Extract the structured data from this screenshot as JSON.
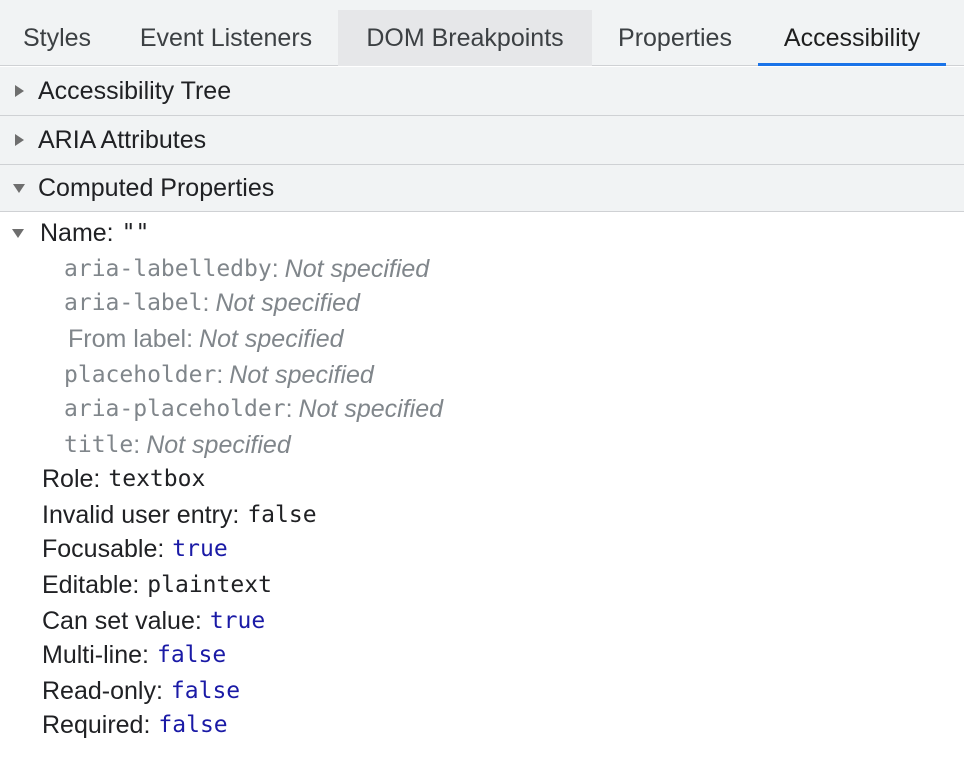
{
  "tabs": [
    {
      "label": "Styles"
    },
    {
      "label": "Event Listeners"
    },
    {
      "label": "DOM Breakpoints"
    },
    {
      "label": "Properties"
    },
    {
      "label": "Accessibility"
    }
  ],
  "sections": {
    "tree": {
      "label": "Accessibility Tree"
    },
    "aria": {
      "label": "ARIA Attributes"
    },
    "computed": {
      "label": "Computed Properties"
    }
  },
  "computed": {
    "name": {
      "label": "Name:",
      "value": "\"\""
    },
    "name_sources": [
      {
        "label": "aria-labelledby",
        "sep": ":",
        "value": "Not specified"
      },
      {
        "label": "aria-label",
        "sep": ":",
        "value": "Not specified"
      },
      {
        "label": "From label",
        "sep": ":",
        "value": "Not specified"
      },
      {
        "label": "placeholder",
        "sep": ":",
        "value": "Not specified"
      },
      {
        "label": "aria-placeholder",
        "sep": ":",
        "value": "Not specified"
      },
      {
        "label": "title",
        "sep": ":",
        "value": "Not specified"
      }
    ],
    "properties": [
      {
        "label": "Role:",
        "value": "textbox"
      },
      {
        "label": "Invalid user entry:",
        "value": "false"
      },
      {
        "label": "Focusable:",
        "value": "true"
      },
      {
        "label": "Editable:",
        "value": "plaintext"
      },
      {
        "label": "Can set value:",
        "value": "true"
      },
      {
        "label": "Multi-line:",
        "value": "false"
      },
      {
        "label": "Read-only:",
        "value": "false"
      },
      {
        "label": "Required:",
        "value": "false"
      }
    ]
  },
  "colors": {
    "accent": "#1a73e8",
    "value_blue": "#1a1aa6",
    "muted": "#80868b",
    "panel_bg": "#f1f3f4"
  }
}
